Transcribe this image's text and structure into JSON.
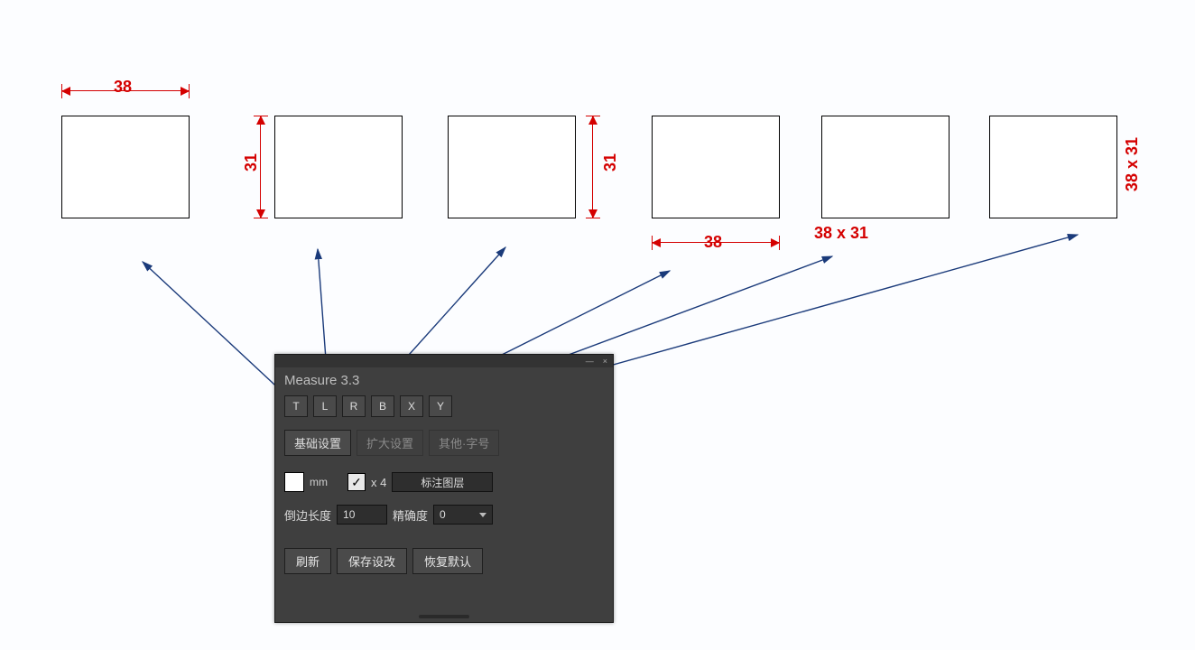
{
  "measurements": {
    "top_width": "38",
    "left_height": "31",
    "right_height": "31",
    "bottom_width": "38",
    "area_label": "38 x 31",
    "side_label": "38 x 31"
  },
  "panel": {
    "title": "Measure 3.3",
    "window_controls": {
      "min": "—",
      "close": "×"
    },
    "mode_buttons": [
      "T",
      "L",
      "R",
      "B",
      "X",
      "Y"
    ],
    "tabs": {
      "active": "基础设置",
      "others": [
        "扩大设置",
        "其他·字号"
      ]
    },
    "unit": "mm",
    "checkbox_checked": true,
    "checkbox_label": "x 4",
    "layer_button": "标注图层",
    "side_len_label": "倒边长度",
    "side_len_value": "10",
    "precision_label": "精确度",
    "precision_value": "0",
    "buttons": {
      "refresh": "刷新",
      "save": "保存设改",
      "reset": "恢复默认"
    }
  }
}
